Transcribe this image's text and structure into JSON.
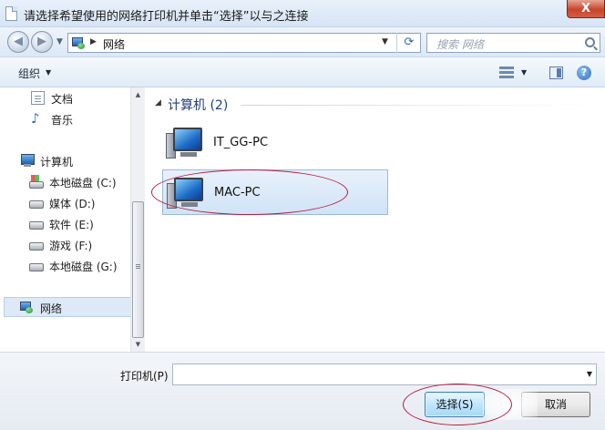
{
  "window": {
    "title": "请选择希望使用的网络打印机并单击“选择”以与之连接",
    "close_label": "X"
  },
  "address_bar": {
    "path": "网络",
    "search_placeholder": "搜索 网络"
  },
  "toolbar": {
    "organize_label": "组织"
  },
  "nav_pane": {
    "libraries": [
      {
        "label": "文档"
      },
      {
        "label": "音乐"
      }
    ],
    "computer": {
      "label": "计算机",
      "drives": [
        {
          "label": "本地磁盘 (C:)"
        },
        {
          "label": "媒体 (D:)"
        },
        {
          "label": "软件 (E:)"
        },
        {
          "label": "游戏 (F:)"
        },
        {
          "label": "本地磁盘 (G:)"
        }
      ]
    },
    "network": {
      "label": "网络",
      "selected": true
    }
  },
  "content": {
    "group_title": "计算机 (2)",
    "computers": [
      {
        "name": "IT_GG-PC",
        "selected": false
      },
      {
        "name": "MAC-PC",
        "selected": true
      }
    ]
  },
  "bottom": {
    "printer_label": "打印机(P)",
    "printer_value": "",
    "select_label": "选择(S)",
    "cancel_label": "取消"
  },
  "colors": {
    "annotation_circle": "#b81c3c",
    "selection_fill": "#d0e3f7"
  }
}
